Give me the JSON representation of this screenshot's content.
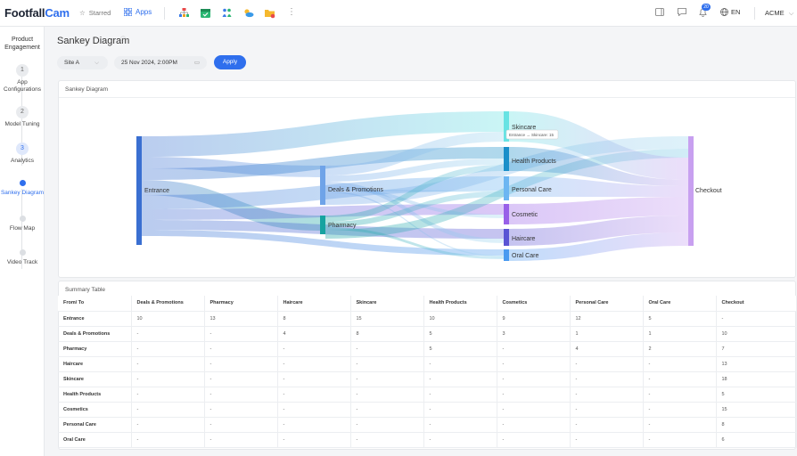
{
  "header": {
    "logo_main": "Footfall",
    "logo_accent": "Cam",
    "starred_label": "Starred",
    "apps_label": "Apps",
    "notifications_count": "20",
    "language": "EN",
    "account": "ACME",
    "app_icons": [
      "org-chart-icon",
      "calendar-icon",
      "people-icon",
      "weather-icon",
      "folder-icon"
    ]
  },
  "sidebar": {
    "title": "Product Engagement",
    "steps": [
      {
        "num": "1",
        "label": "App Configurations"
      },
      {
        "num": "2",
        "label": "Model Tuning"
      },
      {
        "num": "3",
        "label": "Analytics"
      }
    ],
    "subitems": [
      "Sankey Diagram",
      "Flow Map",
      "Video Track"
    ],
    "active_subitem": "Sankey Diagram"
  },
  "page": {
    "title": "Sankey Diagram",
    "site_select": "Site A",
    "date_value": "25 Nov 2024, 2:00PM",
    "apply_label": "Apply"
  },
  "sankey": {
    "card_title": "Sankey Diagram",
    "tooltip": "Entrance → Skincare: 15",
    "nodes": {
      "entrance": "Entrance",
      "deals": "Deals & Promotions",
      "pharmacy": "Pharmacy",
      "skincare": "Skincare",
      "health": "Health Products",
      "personal": "Personal Care",
      "cosmetic": "Cosmetic",
      "haircare": "Haircare",
      "oral": "Oral Care",
      "checkout": "Checkout"
    },
    "colors": {
      "entrance": "#3a6fd1",
      "deals": "#6fa3e8",
      "pharmacy": "#16a3a0",
      "skincare": "#67e3e3",
      "health": "#1a8fc9",
      "personal": "#6cb6f2",
      "cosmetic": "#9860e8",
      "haircare": "#5a54d4",
      "oral": "#4a9af0",
      "checkout": "#c8a0f0"
    }
  },
  "summary": {
    "card_title": "Summary Table",
    "columns": [
      "From/ To",
      "Deals & Promotions",
      "Pharmacy",
      "Haircare",
      "Skincare",
      "Health Products",
      "Cosmetics",
      "Personal Care",
      "Oral Care",
      "Checkout"
    ],
    "rows": [
      [
        "Entrance",
        "10",
        "13",
        "8",
        "15",
        "10",
        "9",
        "12",
        "5",
        "-"
      ],
      [
        "Deals & Promotions",
        "-",
        "-",
        "4",
        "8",
        "5",
        "3",
        "1",
        "1",
        "10"
      ],
      [
        "Pharmacy",
        "-",
        "-",
        "-",
        "-",
        "5",
        "-",
        "4",
        "2",
        "7"
      ],
      [
        "Haircare",
        "-",
        "-",
        "-",
        "-",
        "-",
        "-",
        "-",
        "-",
        "13"
      ],
      [
        "Skincare",
        "-",
        "-",
        "-",
        "-",
        "-",
        "-",
        "-",
        "-",
        "18"
      ],
      [
        "Health Products",
        "-",
        "-",
        "-",
        "-",
        "-",
        "-",
        "-",
        "-",
        "5"
      ],
      [
        "Cosmetics",
        "-",
        "-",
        "-",
        "-",
        "-",
        "-",
        "-",
        "-",
        "15"
      ],
      [
        "Personal Care",
        "-",
        "-",
        "-",
        "-",
        "-",
        "-",
        "-",
        "-",
        "8"
      ],
      [
        "Oral Care",
        "-",
        "-",
        "-",
        "-",
        "-",
        "-",
        "-",
        "-",
        "6"
      ]
    ]
  }
}
